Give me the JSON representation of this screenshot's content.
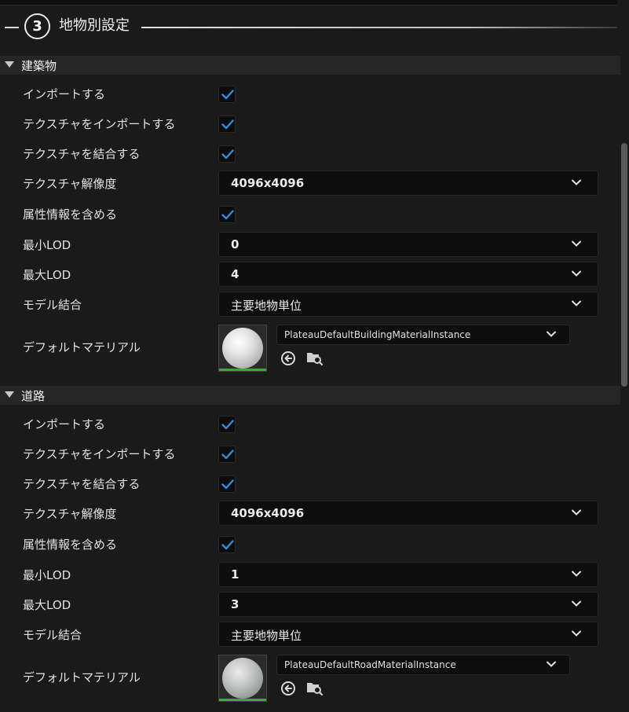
{
  "header": {
    "step_number": "3",
    "title": "地物別設定"
  },
  "sections": [
    {
      "title": "建築物",
      "rows": {
        "import": {
          "label": "インポートする",
          "checked": true
        },
        "import_texture": {
          "label": "テクスチャをインポートする",
          "checked": true
        },
        "merge_texture": {
          "label": "テクスチャを結合する",
          "checked": true
        },
        "texture_resolution": {
          "label": "テクスチャ解像度",
          "value": "4096x4096"
        },
        "include_attributes": {
          "label": "属性情報を含める",
          "checked": true
        },
        "min_lod": {
          "label": "最小LOD",
          "value": "0"
        },
        "max_lod": {
          "label": "最大LOD",
          "value": "4"
        },
        "model_merge": {
          "label": "モデル結合",
          "value": "主要地物単位"
        },
        "default_material": {
          "label": "デフォルトマテリアル",
          "value": "PlateauDefaultBuildingMaterialInstance"
        }
      }
    },
    {
      "title": "道路",
      "rows": {
        "import": {
          "label": "インポートする",
          "checked": true
        },
        "import_texture": {
          "label": "テクスチャをインポートする",
          "checked": true
        },
        "merge_texture": {
          "label": "テクスチャを結合する",
          "checked": true
        },
        "texture_resolution": {
          "label": "テクスチャ解像度",
          "value": "4096x4096"
        },
        "include_attributes": {
          "label": "属性情報を含める",
          "checked": true
        },
        "min_lod": {
          "label": "最小LOD",
          "value": "1"
        },
        "max_lod": {
          "label": "最大LOD",
          "value": "3"
        },
        "model_merge": {
          "label": "モデル結合",
          "value": "主要地物単位"
        },
        "default_material": {
          "label": "デフォルトマテリアル",
          "value": "PlateauDefaultRoadMaterialInstance"
        }
      }
    }
  ],
  "icons": {
    "collapse": "triangle-down-icon",
    "check": "checkmark-icon",
    "dropdown": "chevron-down-icon",
    "use_selected": "arrow-left-circle-icon",
    "browse": "folder-search-icon"
  },
  "colors": {
    "background": "#1a1a1a",
    "section_header": "#262626",
    "field_background": "#0e0e0e",
    "checkmark": "#2f8fe0",
    "thumbnail_bar": "#3aa83a"
  }
}
